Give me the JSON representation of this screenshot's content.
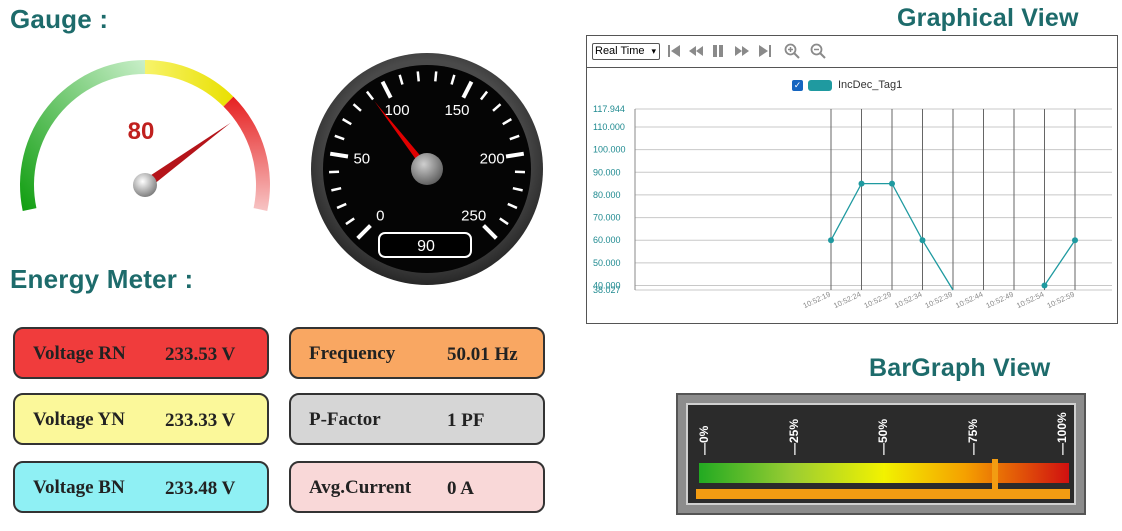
{
  "titles": {
    "gauge": "Gauge :",
    "energy_meter": "Energy Meter :",
    "graphical_view": "Graphical View",
    "bargraph_view": "BarGraph View"
  },
  "semi_gauge": {
    "value": 80,
    "min": 0,
    "max": 100,
    "colors": {
      "green": "#2eae2e",
      "yellow": "#f0e94a",
      "red": "#e8292b",
      "value_text": "#c0201e",
      "needle": "#b5141a"
    }
  },
  "round_gauge": {
    "value": 90,
    "min": 0,
    "max": 250,
    "readout": "90",
    "tick_labels": [
      "0",
      "50",
      "100",
      "150",
      "200",
      "250"
    ],
    "needle_color": "#e00000"
  },
  "energy_meter": {
    "left": [
      {
        "label": "Voltage RN",
        "value": "233.53 V",
        "color": "#f03c3c"
      },
      {
        "label": "Voltage YN",
        "value": "233.33 V",
        "color": "#fbf89a"
      },
      {
        "label": "Voltage BN",
        "value": "233.48 V",
        "color": "#8ff0f4"
      }
    ],
    "right": [
      {
        "label": "Frequency",
        "value": "50.01 Hz",
        "color": "#f9a762"
      },
      {
        "label": "P-Factor",
        "value": "1 PF",
        "color": "#d6d6d6"
      },
      {
        "label": "Avg.Current",
        "value": "0 A",
        "color": "#f9d8d8"
      }
    ]
  },
  "chart_toolbar": {
    "time_mode": "Real Time",
    "icons": [
      "skip-start-icon",
      "rewind-icon",
      "pause-icon",
      "fast-forward-icon",
      "skip-end-icon",
      "zoom-in-icon",
      "zoom-out-icon"
    ]
  },
  "chart_data": {
    "type": "line",
    "legend": {
      "checked": true,
      "label": "IncDec_Tag1",
      "color": "#1f9aa0"
    },
    "y_ticks": [
      "117.944",
      "110.000",
      "100.000",
      "90.000",
      "80.000",
      "70.000",
      "60.000",
      "50.000",
      "40.000",
      "38.027"
    ],
    "ylim": [
      38.027,
      117.944
    ],
    "x_ticks": [
      "10:52:19",
      "10:52:24",
      "10:52:29",
      "10:52:34",
      "10:52:39",
      "10:52:44",
      "10:52:49",
      "10:52:54",
      "10:52:59"
    ],
    "series": [
      {
        "values": [
          {
            "x": "10:52:19",
            "y": 60
          },
          {
            "x": "10:52:24",
            "y": 85
          },
          {
            "x": "10:52:29",
            "y": 85
          },
          {
            "x": "10:52:34",
            "y": 60
          },
          {
            "x": "10:52:39",
            "y": 38.027
          },
          {
            "x": "10:52:54",
            "y": 40
          },
          {
            "x": "10:52:59",
            "y": 60
          }
        ]
      }
    ],
    "grid": true
  },
  "bargraph": {
    "ticks": [
      "0%",
      "25%",
      "50%",
      "75%",
      "100%"
    ],
    "value_percent": 80
  }
}
